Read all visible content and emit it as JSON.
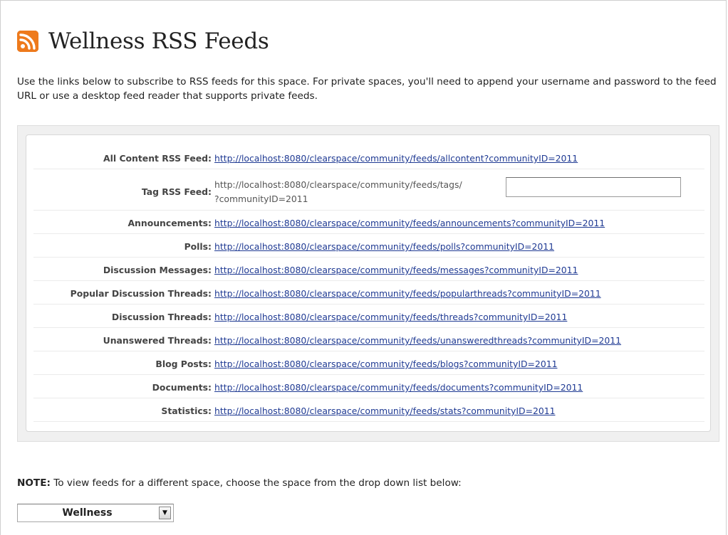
{
  "page": {
    "title": "Wellness RSS Feeds",
    "intro": "Use the links below to subscribe to RSS feeds for this space. For private spaces, you'll need to append your username and password to the feed URL or use a desktop feed reader that supports private feeds."
  },
  "feeds": {
    "all_content": {
      "label": "All Content RSS Feed:",
      "url": "http://localhost:8080/clearspace/community/feeds/allcontent?communityID=2011"
    },
    "tag": {
      "label": "Tag RSS Feed:",
      "url_prefix": "http://localhost:8080/clearspace/community/feeds/tags/",
      "url_suffix": "?communityID=2011",
      "input_value": ""
    },
    "announcements": {
      "label": "Announcements:",
      "url": "http://localhost:8080/clearspace/community/feeds/announcements?communityID=2011"
    },
    "polls": {
      "label": "Polls:",
      "url": "http://localhost:8080/clearspace/community/feeds/polls?communityID=2011"
    },
    "discussion_messages": {
      "label": "Discussion Messages:",
      "url": "http://localhost:8080/clearspace/community/feeds/messages?communityID=2011"
    },
    "popular_threads": {
      "label": "Popular Discussion Threads:",
      "url": "http://localhost:8080/clearspace/community/feeds/popularthreads?communityID=2011"
    },
    "discussion_threads": {
      "label": "Discussion Threads:",
      "url": "http://localhost:8080/clearspace/community/feeds/threads?communityID=2011"
    },
    "unanswered_threads": {
      "label": "Unanswered Threads:",
      "url": "http://localhost:8080/clearspace/community/feeds/unansweredthreads?communityID=2011"
    },
    "blog_posts": {
      "label": "Blog Posts:",
      "url": "http://localhost:8080/clearspace/community/feeds/blogs?communityID=2011"
    },
    "documents": {
      "label": "Documents:",
      "url": "http://localhost:8080/clearspace/community/feeds/documents?communityID=2011"
    },
    "statistics": {
      "label": "Statistics:",
      "url": "http://localhost:8080/clearspace/community/feeds/stats?communityID=2011"
    }
  },
  "note": {
    "prefix": "NOTE:",
    "text": " To view feeds for a different space, choose the space from the drop down list below:"
  },
  "space_select": {
    "selected": "Wellness"
  },
  "icons": {
    "title_icon": "rss-icon",
    "select_arrow": "chevron-down-icon"
  },
  "colors": {
    "rss_orange": "#ee7a1c",
    "link": "#1f3a93"
  }
}
